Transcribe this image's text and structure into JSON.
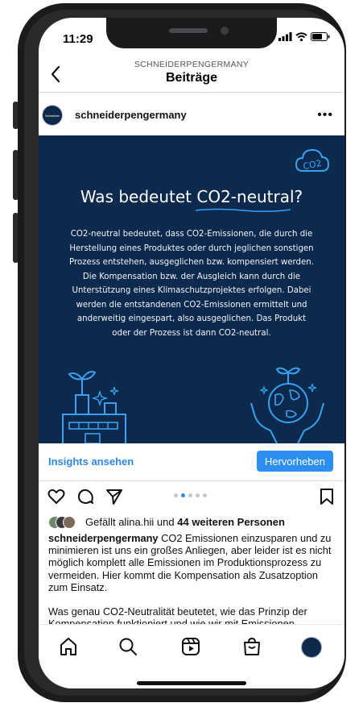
{
  "status": {
    "time": "11:29"
  },
  "header": {
    "account_label": "SCHNEIDERPENGERMANY",
    "title": "Beiträge"
  },
  "post": {
    "username": "schneiderpengermany",
    "avatar_text": "Schneider",
    "image": {
      "badge_text": "CO2",
      "title": "Was bedeutet CO2-neutral?",
      "body": "CO2-neutral bedeutet, dass CO2-Emissionen, die durch die Herstellung eines Produktes oder durch jeglichen sonstigen Prozess entstehen, ausgeglichen bzw. kompensiert werden. Die Kompensation bzw. der Ausgleich kann durch die Unterstützung eines Klimaschutzprojektes erfolgen. Dabei werden die entstandenen CO2-Emissionen ermittelt und anderweitig eingespart, also ausgeglichen. Das Produkt oder der Prozess ist dann CO2-neutral."
    },
    "insights_label": "Insights ansehen",
    "highlight_label": "Hervorheben",
    "carousel": {
      "total": 5,
      "active": 2
    },
    "likes": {
      "prefix": "Gefällt",
      "user": "alina.hii",
      "middle": "und",
      "others": "44 weiteren Personen"
    },
    "caption": {
      "username": "schneiderpengermany",
      "text": "CO2 Emissionen einzusparen und zu minimieren ist uns ein großes Anliegen, aber leider ist es nicht möglich komplett alle Emissionen im Produktionsprozess zu vermeiden. Hier kommt die Kompensation als Zusatzoption zum Einsatz.",
      "text2": "Was genau CO2-Neutralität beutetet, wie das Prinzip der Kompensation funktioniert und wie wir mit Emissionen"
    }
  },
  "colors": {
    "accent": "#2c8ff0",
    "post_background": "#0c2a4e",
    "illustration_line": "#3aa0f0"
  },
  "icons": {
    "header": [
      "back-icon"
    ],
    "actions": [
      "heart-icon",
      "comment-icon",
      "share-icon",
      "bookmark-icon"
    ],
    "nav": [
      "home-icon",
      "search-icon",
      "reels-icon",
      "shop-icon",
      "profile-avatar"
    ]
  }
}
